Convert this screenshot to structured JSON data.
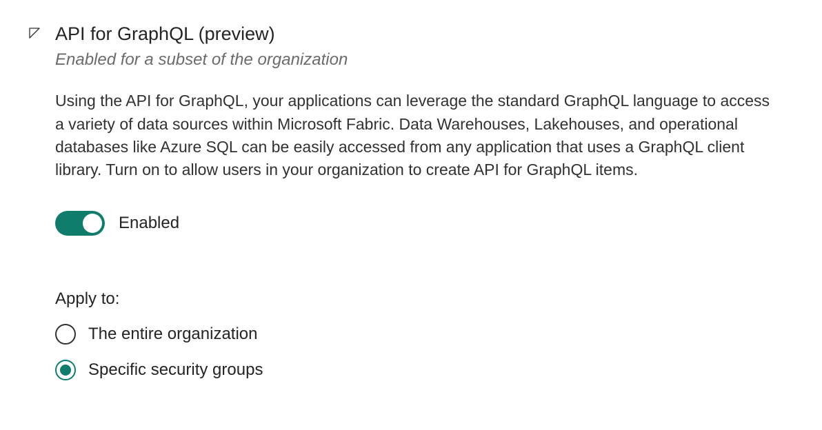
{
  "setting": {
    "title": "API for GraphQL (preview)",
    "subtitle": "Enabled for a subset of the organization",
    "description": "Using the API for GraphQL, your applications can leverage the standard GraphQL language to access a variety of data sources within Microsoft Fabric. Data Warehouses, Lakehouses, and operational databases like Azure SQL can be easily accessed from any application that uses a GraphQL client library. Turn on to allow users in your organization to create API for GraphQL items.",
    "toggle": {
      "label": "Enabled",
      "state": "on"
    },
    "applyTo": {
      "heading": "Apply to:",
      "options": [
        {
          "label": "The entire organization",
          "selected": false
        },
        {
          "label": "Specific security groups",
          "selected": true
        }
      ]
    }
  },
  "colors": {
    "accent": "#107c6c"
  }
}
